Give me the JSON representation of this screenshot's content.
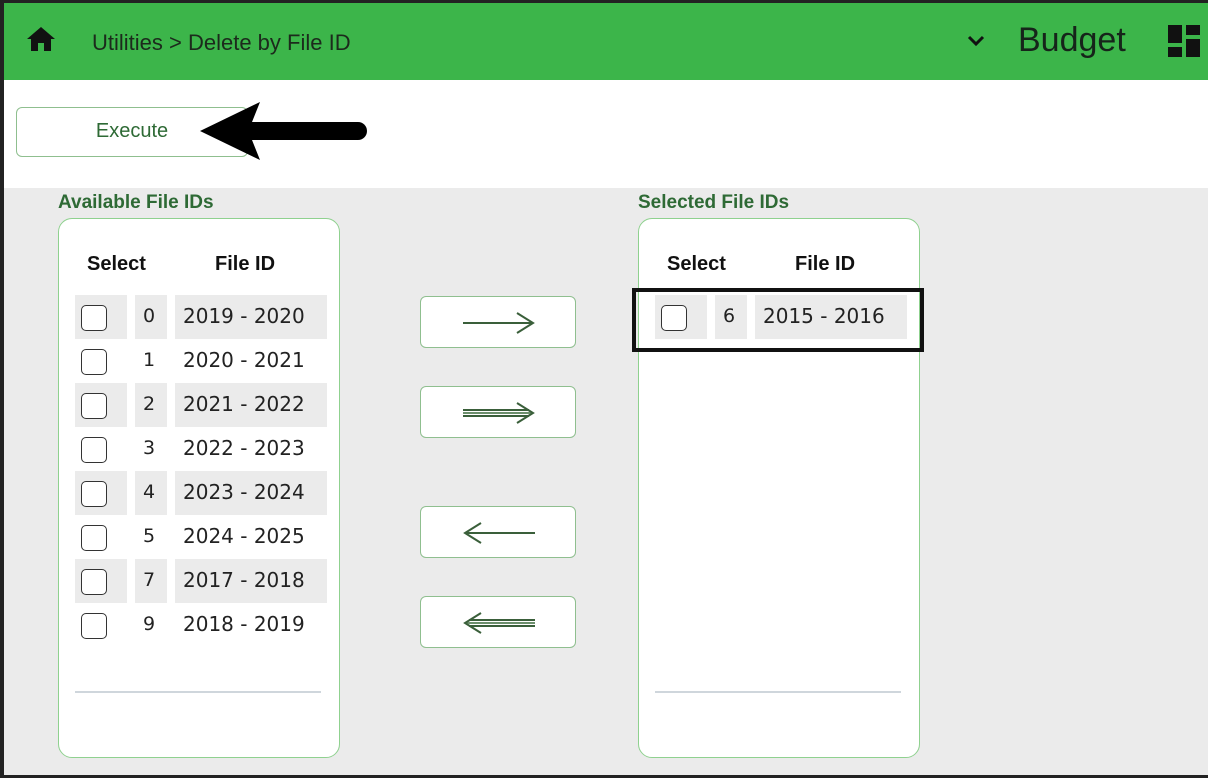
{
  "header": {
    "breadcrumb": "Utilities > Delete by File ID",
    "app_title": "Budget",
    "accent_color": "#3cb54a",
    "icons": [
      "home-icon",
      "chevron-down-icon",
      "dashboard-grid-icon"
    ]
  },
  "toolbar": {
    "execute_label": "Execute"
  },
  "available": {
    "label": "Available File IDs",
    "col_select": "Select",
    "col_file_id": "File ID",
    "rows": [
      {
        "num": "0",
        "file_id": "2019 - 2020",
        "checked": false
      },
      {
        "num": "1",
        "file_id": "2020 - 2021",
        "checked": false
      },
      {
        "num": "2",
        "file_id": "2021 - 2022",
        "checked": false
      },
      {
        "num": "3",
        "file_id": "2022 - 2023",
        "checked": false
      },
      {
        "num": "4",
        "file_id": "2023 - 2024",
        "checked": false
      },
      {
        "num": "5",
        "file_id": "2024 - 2025",
        "checked": false
      },
      {
        "num": "7",
        "file_id": "2017 - 2018",
        "checked": false
      },
      {
        "num": "9",
        "file_id": "2018 - 2019",
        "checked": false
      }
    ]
  },
  "selected": {
    "label": "Selected File IDs",
    "col_select": "Select",
    "col_file_id": "File ID",
    "rows": [
      {
        "num": "6",
        "file_id": "2015 - 2016",
        "checked": false
      }
    ]
  },
  "move_buttons": [
    "move-right-icon",
    "move-all-right-icon",
    "move-left-icon",
    "move-all-left-icon"
  ]
}
